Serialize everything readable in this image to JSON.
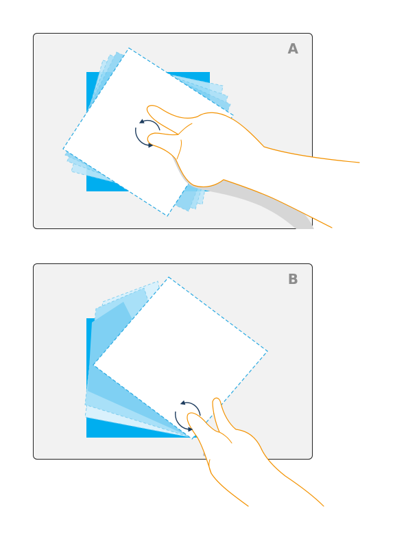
{
  "panels": [
    {
      "letter": "A",
      "gesture": "two-finger-rotate"
    },
    {
      "letter": "B",
      "gesture": "thumb-index-rotate"
    }
  ],
  "colors": {
    "background": "#ffffff",
    "panel_fill": "#f2f2f2",
    "panel_border": "#222222",
    "letter": "#8c8c8c",
    "photo_blue": "#00aeef",
    "ghost_blue": "#8fd6f5",
    "dashed_outline": "#29a9e1",
    "hand_outline": "#f39200",
    "hand_shadow": "#d6d6d6",
    "rotate_arrows": "#1d3c5e"
  },
  "icons": [
    "hand-icon",
    "rotate-arrows-icon"
  ]
}
